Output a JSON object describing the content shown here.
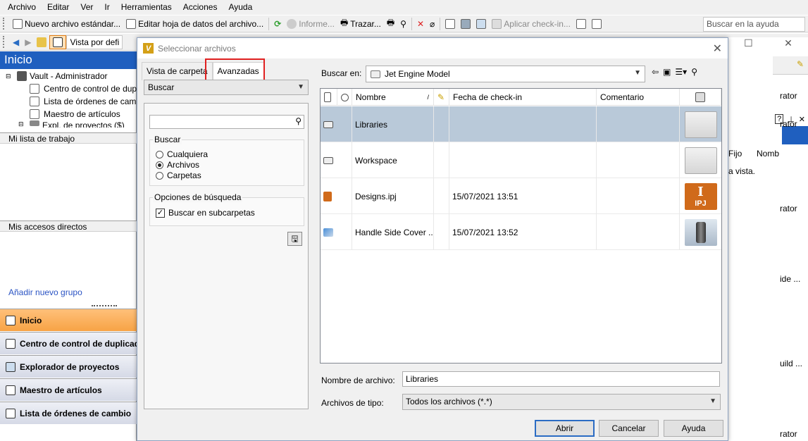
{
  "menu": [
    "Archivo",
    "Editar",
    "Ver",
    "Ir",
    "Herramientas",
    "Acciones",
    "Ayuda"
  ],
  "toolbar1": {
    "new_file": "Nuevo archivo estándar...",
    "edit_datasheet": "Editar hoja de datos del archivo...",
    "report": "Informe...",
    "trace": "Trazar...",
    "apply_checkin": "Aplicar check-in...",
    "help_search_placeholder": "Buscar en la ayuda"
  },
  "toolbar2": {
    "view_default": "Vista por defi"
  },
  "left": {
    "title": "Inicio",
    "tree": [
      {
        "label": "Vault - Administrador"
      },
      {
        "label": "Centro de control de dup"
      },
      {
        "label": "Lista de órdenes de camb"
      },
      {
        "label": "Maestro de artículos"
      },
      {
        "label": "Expl. de proyectos ($)"
      }
    ],
    "worklist": "Mi lista de trabajo",
    "shortcuts": "Mis accesos directos",
    "add_group": "Añadir nuevo grupo",
    "nav": [
      {
        "label": "Inicio"
      },
      {
        "label": "Centro de control de duplicad"
      },
      {
        "label": "Explorador de proyectos"
      },
      {
        "label": "Maestro de artículos"
      },
      {
        "label": "Lista de órdenes de cambio"
      }
    ]
  },
  "right_bg": [
    "rator",
    "Fijo",
    "Nomb",
    "a vista.",
    "rator",
    "ide ...",
    "uild ...",
    "rator"
  ],
  "dialog": {
    "title": "Seleccionar archivos",
    "tabs": [
      "Vista de carpeta",
      "Avanzadas"
    ],
    "search_combo": "Buscar",
    "group_search": "Buscar",
    "radios": [
      "Cualquiera",
      "Archivos",
      "Carpetas"
    ],
    "group_options": "Opciones de búsqueda",
    "checkbox_subfolders": "Buscar en subcarpetas",
    "look_in_label": "Buscar en:",
    "look_in_value": "Jet Engine Model",
    "columns": {
      "name": "Nombre",
      "checkin": "Fecha de check-in",
      "comment": "Comentario"
    },
    "files": [
      {
        "name": "Libraries",
        "date": "",
        "kind": "folder"
      },
      {
        "name": "Workspace",
        "date": "",
        "kind": "folder"
      },
      {
        "name": "Designs.ipj",
        "date": "15/07/2021 13:51",
        "kind": "ipj",
        "thumb_label": "IPJ"
      },
      {
        "name": "Handle Side Cover ...",
        "date": "15/07/2021 13:52",
        "kind": "part"
      }
    ],
    "filename_label": "Nombre de archivo:",
    "filename_value": "Libraries",
    "filetype_label": "Archivos de tipo:",
    "filetype_value": "Todos los archivos (*.*)",
    "buttons": {
      "open": "Abrir",
      "cancel": "Cancelar",
      "help": "Ayuda"
    }
  }
}
